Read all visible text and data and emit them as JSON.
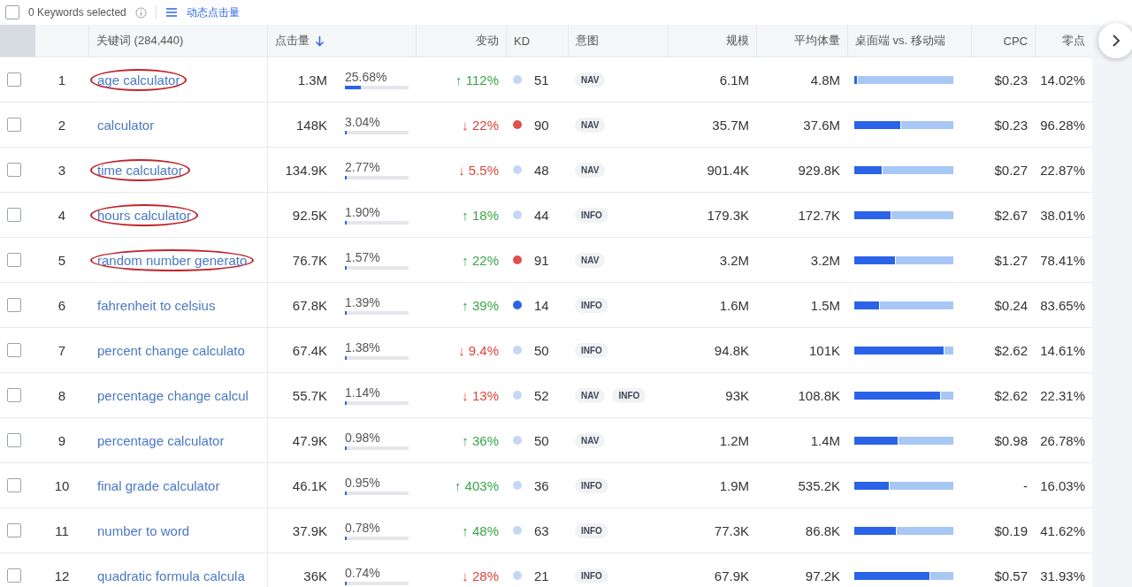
{
  "toolbar": {
    "checked": false,
    "selected_label": "0 Keywords selected",
    "view_label": "动态点击量"
  },
  "table": {
    "columns": [
      "关键词 (284,440)",
      "点击量",
      "变动",
      "KD",
      "意图",
      "规模",
      "平均体量",
      "桌面端 vs. 移动端",
      "CPC",
      "零点"
    ],
    "rows": [
      {
        "checked": false,
        "rank": "1",
        "keyword": "age calculator",
        "circled": true,
        "clicks": "1.3M",
        "share": "25.68%",
        "level": 0.2568,
        "up": true,
        "change": "↑ 112%",
        "kd": "51",
        "color": "#c5d7f5",
        "intents": [
          "NAV"
        ],
        "scale": "6.1M",
        "avg": "4.8M",
        "desktop": {
          "level": 0.03
        },
        "cpc": "$0.23",
        "zero": "14.02%"
      },
      {
        "checked": false,
        "rank": "2",
        "keyword": "calculator",
        "circled": false,
        "clicks": "148K",
        "share": "3.04%",
        "level": 0.0304,
        "up": false,
        "change": "↓ 22%",
        "kd": "90",
        "color": "#e0504d",
        "intents": [
          "NAV"
        ],
        "scale": "35.7M",
        "avg": "37.6M",
        "desktop": {
          "level": 0.46
        },
        "cpc": "$0.23",
        "zero": "96.28%"
      },
      {
        "checked": false,
        "rank": "3",
        "keyword": "time calculator",
        "circled": true,
        "clicks": "134.9K",
        "share": "2.77%",
        "level": 0.0277,
        "up": false,
        "change": "↓ 5.5%",
        "kd": "48",
        "color": "#c5d7f5",
        "intents": [
          "NAV"
        ],
        "scale": "901.4K",
        "avg": "929.8K",
        "desktop": {
          "level": 0.28
        },
        "cpc": "$0.27",
        "zero": "22.87%"
      },
      {
        "checked": false,
        "rank": "4",
        "keyword": "hours calculator",
        "circled": true,
        "clicks": "92.5K",
        "share": "1.90%",
        "level": 0.019,
        "up": true,
        "change": "↑ 18%",
        "kd": "44",
        "color": "#c5d7f5",
        "intents": [
          "INFO"
        ],
        "scale": "179.3K",
        "avg": "172.7K",
        "desktop": {
          "level": 0.37
        },
        "cpc": "$2.67",
        "zero": "38.01%"
      },
      {
        "checked": false,
        "rank": "5",
        "keyword": "random number generato",
        "circled": true,
        "clicks": "76.7K",
        "share": "1.57%",
        "level": 0.0157,
        "up": true,
        "change": "↑ 22%",
        "kd": "91",
        "color": "#e0504d",
        "intents": [
          "NAV"
        ],
        "scale": "3.2M",
        "avg": "3.2M",
        "desktop": {
          "level": 0.41
        },
        "cpc": "$1.27",
        "zero": "78.41%"
      },
      {
        "checked": false,
        "rank": "6",
        "keyword": "fahrenheit to celsius",
        "circled": false,
        "clicks": "67.8K",
        "share": "1.39%",
        "level": 0.0139,
        "up": true,
        "change": "↑ 39%",
        "kd": "14",
        "color": "#2b63e8",
        "intents": [
          "INFO"
        ],
        "scale": "1.6M",
        "avg": "1.5M",
        "desktop": {
          "level": 0.25
        },
        "cpc": "$0.24",
        "zero": "83.65%"
      },
      {
        "checked": false,
        "rank": "7",
        "keyword": "percent change calculato",
        "circled": false,
        "clicks": "67.4K",
        "share": "1.38%",
        "level": 0.0138,
        "up": false,
        "change": "↓ 9.4%",
        "kd": "50",
        "color": "#c5d7f5",
        "intents": [
          "INFO"
        ],
        "scale": "94.8K",
        "avg": "101K",
        "desktop": {
          "level": 0.9
        },
        "cpc": "$2.62",
        "zero": "14.61%"
      },
      {
        "checked": false,
        "rank": "8",
        "keyword": "percentage change calcul",
        "circled": false,
        "clicks": "55.7K",
        "share": "1.14%",
        "level": 0.0114,
        "up": false,
        "change": "↓ 13%",
        "kd": "52",
        "color": "#c5d7f5",
        "intents": [
          "NAV",
          "INFO"
        ],
        "scale": "93K",
        "avg": "108.8K",
        "desktop": {
          "level": 0.87
        },
        "cpc": "$2.62",
        "zero": "22.31%"
      },
      {
        "checked": false,
        "rank": "9",
        "keyword": "percentage calculator",
        "circled": false,
        "clicks": "47.9K",
        "share": "0.98%",
        "level": 0.0098,
        "up": true,
        "change": "↑ 36%",
        "kd": "50",
        "color": "#c5d7f5",
        "intents": [
          "NAV"
        ],
        "scale": "1.2M",
        "avg": "1.4M",
        "desktop": {
          "level": 0.44
        },
        "cpc": "$0.98",
        "zero": "26.78%"
      },
      {
        "checked": false,
        "rank": "10",
        "keyword": "final grade calculator",
        "circled": false,
        "clicks": "46.1K",
        "share": "0.95%",
        "level": 0.0095,
        "up": true,
        "change": "↑ 403%",
        "kd": "36",
        "color": "#c5d7f5",
        "intents": [
          "INFO"
        ],
        "scale": "1.9M",
        "avg": "535.2K",
        "desktop": {
          "level": 0.35
        },
        "cpc": "-",
        "zero": "16.03%"
      },
      {
        "checked": false,
        "rank": "11",
        "keyword": "number to word",
        "circled": false,
        "clicks": "37.9K",
        "share": "0.78%",
        "level": 0.0078,
        "up": true,
        "change": "↑ 48%",
        "kd": "63",
        "color": "#c5d7f5",
        "intents": [
          "INFO"
        ],
        "scale": "77.3K",
        "avg": "86.8K",
        "desktop": {
          "level": 0.42
        },
        "cpc": "$0.19",
        "zero": "41.62%"
      },
      {
        "checked": false,
        "rank": "12",
        "keyword": "quadratic formula calcula",
        "circled": false,
        "clicks": "36K",
        "share": "0.74%",
        "level": 0.0074,
        "up": false,
        "change": "↓ 28%",
        "kd": "21",
        "color": "#c5d7f5",
        "intents": [
          "INFO"
        ],
        "scale": "67.9K",
        "avg": "97.2K",
        "desktop": {
          "level": 0.76
        },
        "cpc": "$0.57",
        "zero": "31.93%"
      }
    ]
  }
}
